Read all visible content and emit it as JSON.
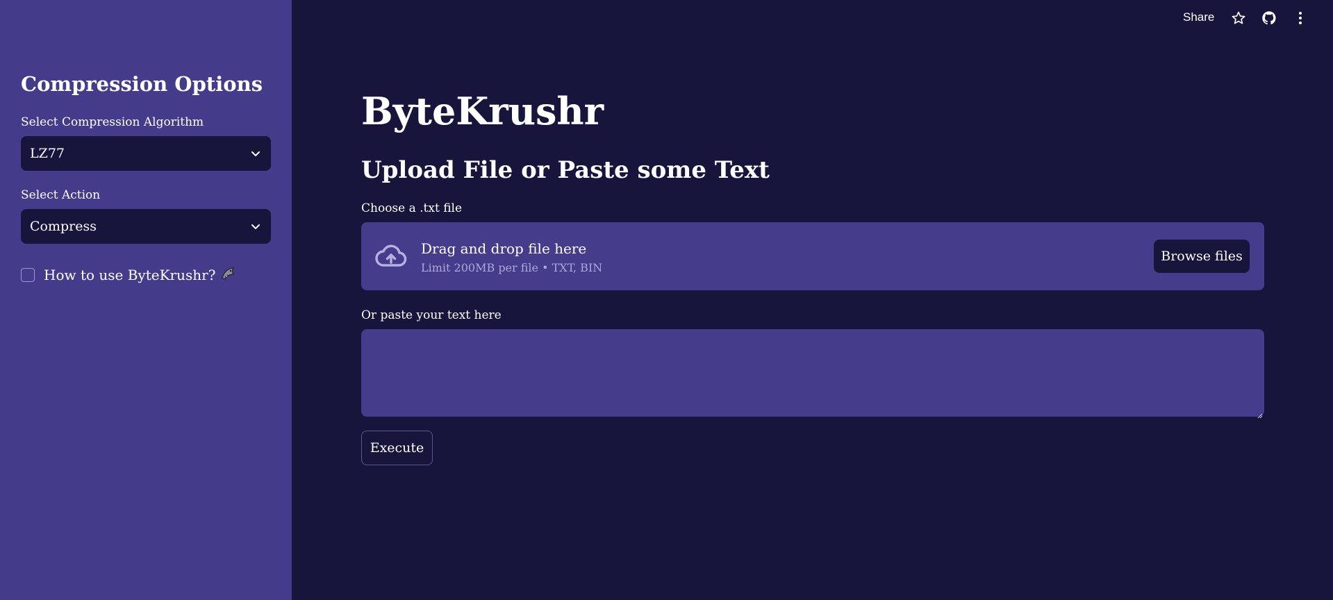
{
  "sidebar": {
    "title": "Compression Options",
    "algorithm": {
      "label": "Select Compression Algorithm",
      "value": "LZ77"
    },
    "action": {
      "label": "Select Action",
      "value": "Compress"
    },
    "howto": {
      "label": "How to use ByteKrushr?",
      "icon": "shark-icon",
      "checked": false
    }
  },
  "topbar": {
    "share_label": "Share",
    "icons": [
      "star-icon",
      "github-icon",
      "more-vertical-icon"
    ]
  },
  "main": {
    "title": "ByteKrushr",
    "subtitle": "Upload File or Paste some Text",
    "file_label": "Choose a .txt file",
    "dropzone": {
      "title": "Drag and drop file here",
      "subtitle": "Limit 200MB per file • TXT, BIN",
      "browse_label": "Browse files",
      "icon": "cloud-upload-icon"
    },
    "text_label": "Or paste your text here",
    "text_value": "",
    "execute_label": "Execute"
  },
  "colors": {
    "background": "#17153b",
    "sidebar": "#443c8a",
    "panel": "#453d8c",
    "text": "#ffffff",
    "muted": "#aea7d8"
  }
}
